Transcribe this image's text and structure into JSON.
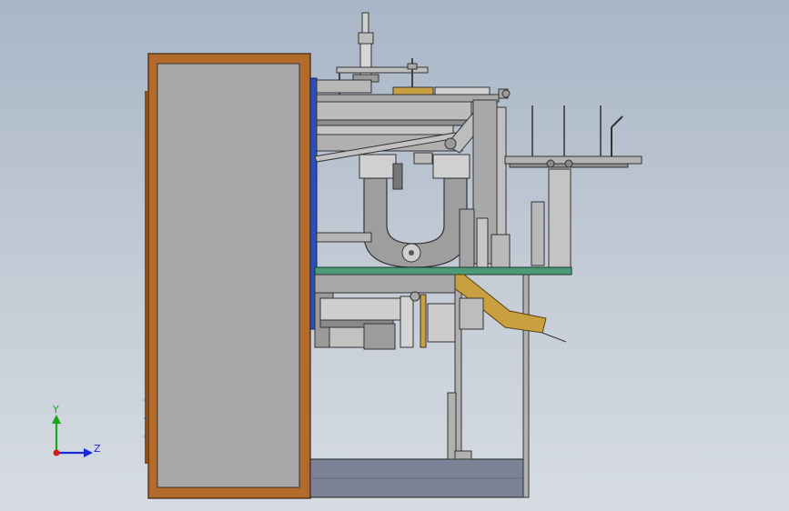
{
  "scene": {
    "view": "side view",
    "background_colors": [
      "#a9b6c7",
      "#d7dce3"
    ],
    "colors": {
      "cabinet_frame": "#b26b2a",
      "cabinet_panel": "#a8a8a8",
      "mount_plate": "#2a4fb8",
      "table_plate": "#4c9a78",
      "chute": "#c8a040",
      "base_box": "#7d8397",
      "steel": "#9a9a9a",
      "steel_dark": "#5a5a5a",
      "roller": "#c9c9c9"
    }
  },
  "axis_triad": {
    "y_label": "Y",
    "z_label": "Z",
    "y_color": "#1aa51a",
    "z_color": "#1a2ad8",
    "x_color": "#d81a1a"
  }
}
